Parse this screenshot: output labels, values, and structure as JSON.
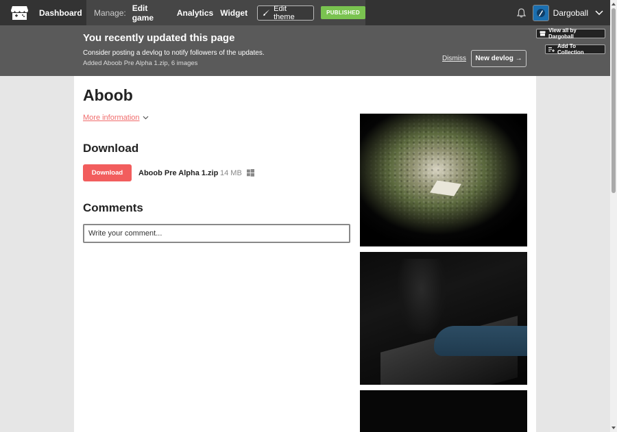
{
  "topbar": {
    "dashboard_label": "Dashboard",
    "manage_label": "Manage:",
    "nav": [
      "Edit game",
      "Analytics",
      "Widget"
    ],
    "edit_theme_label": "Edit theme",
    "published_label": "PUBLISHED",
    "username": "Dargoball"
  },
  "banner": {
    "title": "You recently updated this page",
    "message": "Consider posting a devlog to notify followers of the updates.",
    "sub": "Added Aboob Pre Alpha 1.zip, 6 images",
    "dismiss_label": "Dismiss",
    "new_devlog_label": "New devlog →",
    "view_all_label": "View all by Dargoball",
    "add_collection_label": "Add To Collection"
  },
  "game": {
    "title": "Aboob",
    "more_info_label": "More information",
    "download_heading": "Download",
    "download_button": "Download",
    "file_name": "Aboob Pre Alpha 1.zip",
    "file_size": "14 MB",
    "comments_heading": "Comments",
    "comment_placeholder": "Write your comment..."
  },
  "colors": {
    "accent": "#f25d5d",
    "published": "#7ac350",
    "topbar": "#333333",
    "banner": "#5a5a5a"
  }
}
